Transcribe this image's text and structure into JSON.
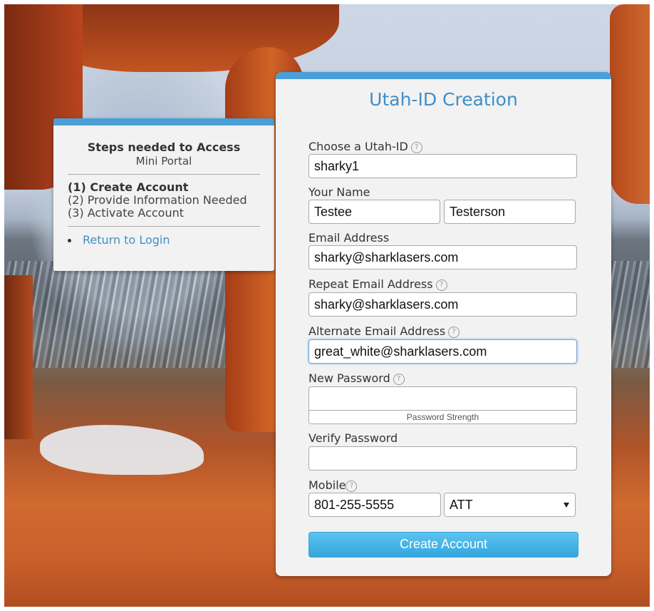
{
  "steps_panel": {
    "title": "Steps needed to Access",
    "subtitle": "Mini Portal",
    "steps": [
      "(1) Create Account",
      "(2) Provide Information Needed",
      "(3) Activate Account"
    ],
    "return_link": "Return to Login"
  },
  "form": {
    "title": "Utah-ID Creation",
    "utah_id": {
      "label": "Choose a Utah-ID",
      "value": "sharky1"
    },
    "name": {
      "label": "Your Name",
      "first": "Testee",
      "last": "Testerson"
    },
    "email": {
      "label": "Email Address",
      "value": "sharky@sharklasers.com"
    },
    "repeat_email": {
      "label": "Repeat Email Address",
      "value": "sharky@sharklasers.com"
    },
    "alternate_email": {
      "label": "Alternate Email Address",
      "value": "great_white@sharklasers.com"
    },
    "new_password": {
      "label": "New Password",
      "value": "",
      "strength_label": "Password Strength"
    },
    "verify_password": {
      "label": "Verify Password",
      "value": ""
    },
    "mobile": {
      "label": "Mobile",
      "value": "801-255-5555",
      "carrier": "ATT"
    },
    "submit_label": "Create Account"
  },
  "icons": {
    "help": "help-circle-icon",
    "dropdown": "chevron-down-icon"
  },
  "colors": {
    "accent": "#4a9fd6",
    "link": "#3f8fc7",
    "button": "#34a6de"
  }
}
